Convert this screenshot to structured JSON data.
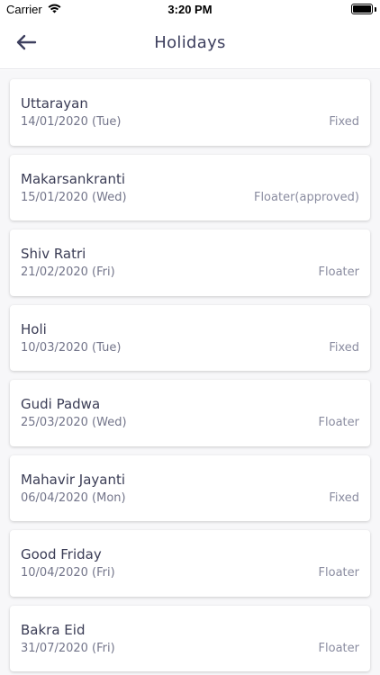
{
  "status_bar": {
    "carrier": "Carrier",
    "time": "3:20 PM"
  },
  "nav": {
    "title": "Holidays",
    "back_icon": "arrow-left-icon"
  },
  "holidays": [
    {
      "name": "Uttarayan",
      "date": "14/01/2020 (Tue)",
      "type": "Fixed"
    },
    {
      "name": "Makarsankranti",
      "date": "15/01/2020 (Wed)",
      "type": "Floater(approved)"
    },
    {
      "name": "Shiv Ratri",
      "date": "21/02/2020 (Fri)",
      "type": "Floater"
    },
    {
      "name": "Holi",
      "date": "10/03/2020 (Tue)",
      "type": "Fixed"
    },
    {
      "name": "Gudi Padwa",
      "date": "25/03/2020 (Wed)",
      "type": "Floater"
    },
    {
      "name": "Mahavir Jayanti",
      "date": "06/04/2020 (Mon)",
      "type": "Fixed"
    },
    {
      "name": "Good Friday",
      "date": "10/04/2020 (Fri)",
      "type": "Floater"
    },
    {
      "name": "Bakra Eid",
      "date": "31/07/2020 (Fri)",
      "type": "Floater"
    }
  ],
  "colors": {
    "title": "#3d3f5e",
    "text_primary": "#3a3c55",
    "text_secondary": "#73758a"
  }
}
